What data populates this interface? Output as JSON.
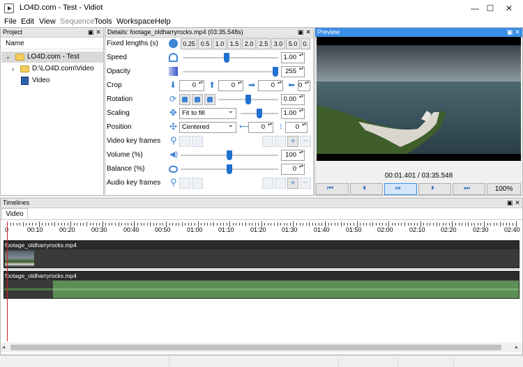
{
  "window": {
    "title": "LO4D.com - Test - Vidiot",
    "minimize": "—",
    "maximize": "☐",
    "close": "✕"
  },
  "menu": {
    "items": [
      "File",
      "Edit",
      "View",
      "Sequence",
      "Tools",
      "Workspace",
      "Help"
    ],
    "disabled": [
      "Sequence"
    ]
  },
  "project": {
    "title": "Project",
    "column": "Name",
    "items": [
      {
        "label": "LO4D.com - Test",
        "type": "folder",
        "expanded": true,
        "selected": true
      },
      {
        "label": "D:\\LO4D.com\\Video",
        "type": "folder",
        "expanded": false
      },
      {
        "label": "Video",
        "type": "sequence"
      }
    ]
  },
  "details": {
    "title": "Details: footage_oldharryrocks.mp4 (03:35.548s)",
    "fixed_lengths": {
      "label": "Fixed lengths (s)",
      "values": [
        "0.25",
        "0.5",
        "1.0",
        "1.5",
        "2.0",
        "2.5",
        "3.0",
        "5.0",
        "0."
      ]
    },
    "speed": {
      "label": "Speed",
      "value": "1.00",
      "slider": 0.45
    },
    "opacity": {
      "label": "Opacity",
      "value": "255",
      "slider": 1.0
    },
    "crop": {
      "label": "Crop",
      "top": "0",
      "left": "0",
      "right": "0",
      "bottom": "0"
    },
    "rotation": {
      "label": "Rotation",
      "value": "0.00",
      "slider": 0.5
    },
    "scaling": {
      "label": "Scaling",
      "option": "Fit to fill",
      "value": "1.00",
      "slider": 0.5
    },
    "position": {
      "label": "Position",
      "option": "Centered",
      "x": "0",
      "y": "0"
    },
    "video_keyframes": {
      "label": "Video key frames"
    },
    "volume": {
      "label": "Volume (%)",
      "value": "100",
      "slider": 0.5
    },
    "balance": {
      "label": "Balance (%)",
      "value": "0",
      "slider": 0.5
    },
    "audio_keyframes": {
      "label": "Audio key frames"
    }
  },
  "preview": {
    "title": "Preview",
    "time": "00:01.401 / 03:35.548",
    "zoom": "100%"
  },
  "timelines": {
    "title": "Timelines",
    "tab": "Video",
    "ruler": [
      "0",
      "00:10",
      "00:20",
      "00:30",
      "00:40",
      "00:50",
      "01:00",
      "01:10",
      "01:20",
      "01:30",
      "01:40",
      "01:50",
      "02:00",
      "02:10",
      "02:20",
      "02:30",
      "02:40"
    ],
    "video_clip": "footage_oldharryrocks.mp4",
    "audio_clip": "footage_oldharryrocks.mp4"
  },
  "colors": {
    "accent": "#3a8ee6",
    "slider": "#1f70d1",
    "audio_wave": "#5c8f55",
    "cursor": "#d22020"
  }
}
